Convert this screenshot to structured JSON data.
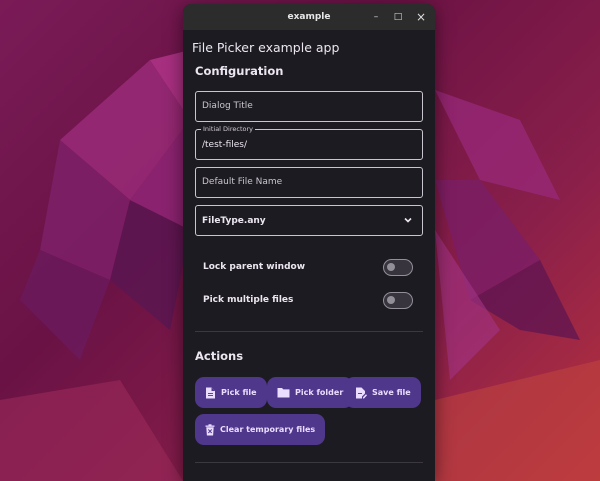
{
  "window": {
    "title": "example",
    "minimize_glyph": "–",
    "maximize_glyph": "□",
    "close_glyph": "×"
  },
  "app": {
    "title": "File Picker example app"
  },
  "configuration": {
    "heading": "Configuration",
    "dialog_title": {
      "placeholder": "Dialog Title",
      "value": ""
    },
    "initial_directory": {
      "label": "Initial Directory",
      "value": "/test-files/"
    },
    "default_file_name": {
      "placeholder": "Default File Name",
      "value": ""
    },
    "file_type": {
      "value": "FileType.any"
    },
    "lock_parent_window": {
      "label": "Lock parent window",
      "on": false
    },
    "pick_multiple_files": {
      "label": "Pick multiple files",
      "on": false
    }
  },
  "actions": {
    "heading": "Actions",
    "buttons": [
      {
        "label": "Pick file",
        "icon": "file-icon"
      },
      {
        "label": "Pick folder",
        "icon": "folder-icon"
      },
      {
        "label": "Save file",
        "icon": "save-file-icon"
      },
      {
        "label": "Clear temporary files",
        "icon": "delete-icon"
      }
    ]
  },
  "colors": {
    "window_bg": "#1d1b22",
    "button_bg": "#4f378b",
    "button_text": "#eaddff",
    "outline": "#c9c4cf"
  }
}
